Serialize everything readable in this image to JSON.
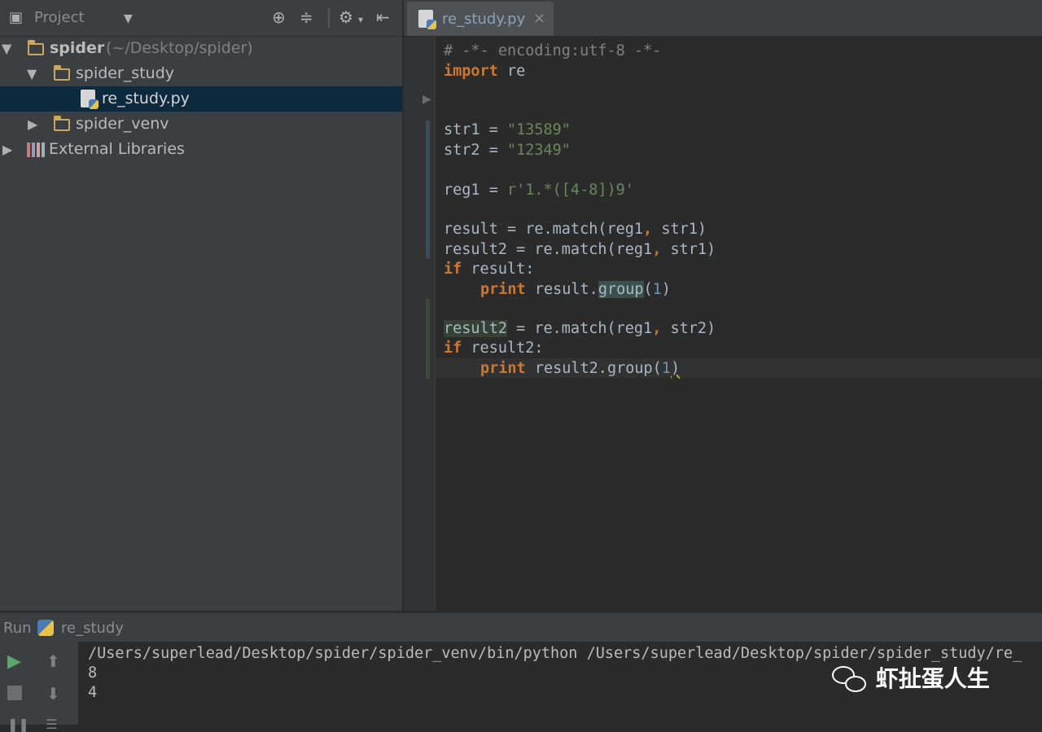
{
  "project_panel": {
    "title": "Project",
    "dropdown_icon": "chevron-down-icon",
    "tree": [
      {
        "label": "spider",
        "hint": "(~/Desktop/spider)",
        "icon": "folder-icon",
        "expanded": true
      },
      {
        "label": "spider_study",
        "icon": "folder-icon",
        "expanded": true
      },
      {
        "label": "re_study.py",
        "icon": "python-file-icon",
        "selected": true
      },
      {
        "label": "spider_venv",
        "icon": "folder-icon",
        "expanded": false
      },
      {
        "label": "External Libraries",
        "icon": "libraries-icon",
        "expanded": false
      }
    ]
  },
  "editor": {
    "tab": {
      "label": "re_study.py",
      "close": "×"
    },
    "code": {
      "l1": "# -*- encoding:utf-8 -*-",
      "l2_kw": "import",
      "l2_rest": " re",
      "l5_a": "str1 = ",
      "l5_s": "\"13589\"",
      "l6_a": "str2 = ",
      "l6_s": "\"12349\"",
      "l8_a": "reg1 = ",
      "l8_s": "r'1.*([4-8])9'",
      "l10_a": "result = re.match(reg1",
      "l10_c": ",",
      "l10_b": " str1)",
      "l11_a": "result2 = re.match(reg1",
      "l11_c": ",",
      "l11_b": " str1)",
      "l12_kw": "if",
      "l12_rest": " result:",
      "l13_kw": "print",
      "l13_a": " result.",
      "l13_g": "group",
      "l13_p1": "(",
      "l13_n": "1",
      "l13_p2": ")",
      "l15_h": "result2",
      "l15_a": " = re.match(reg1",
      "l15_c": ",",
      "l15_b": " str2)",
      "l16_kw": "if",
      "l16_rest": " result2:",
      "l17_kw": "print",
      "l17_a": " result2.",
      "l17_g": "group",
      "l17_p1": "(",
      "l17_n": "1",
      "l17_p2": ")"
    }
  },
  "run_panel": {
    "title": "Run",
    "config": "re_study",
    "console": [
      "/Users/superlead/Desktop/spider/spider_venv/bin/python /Users/superlead/Desktop/spider/spider_study/re_",
      "8",
      "4"
    ]
  },
  "watermark": "虾扯蛋人生"
}
